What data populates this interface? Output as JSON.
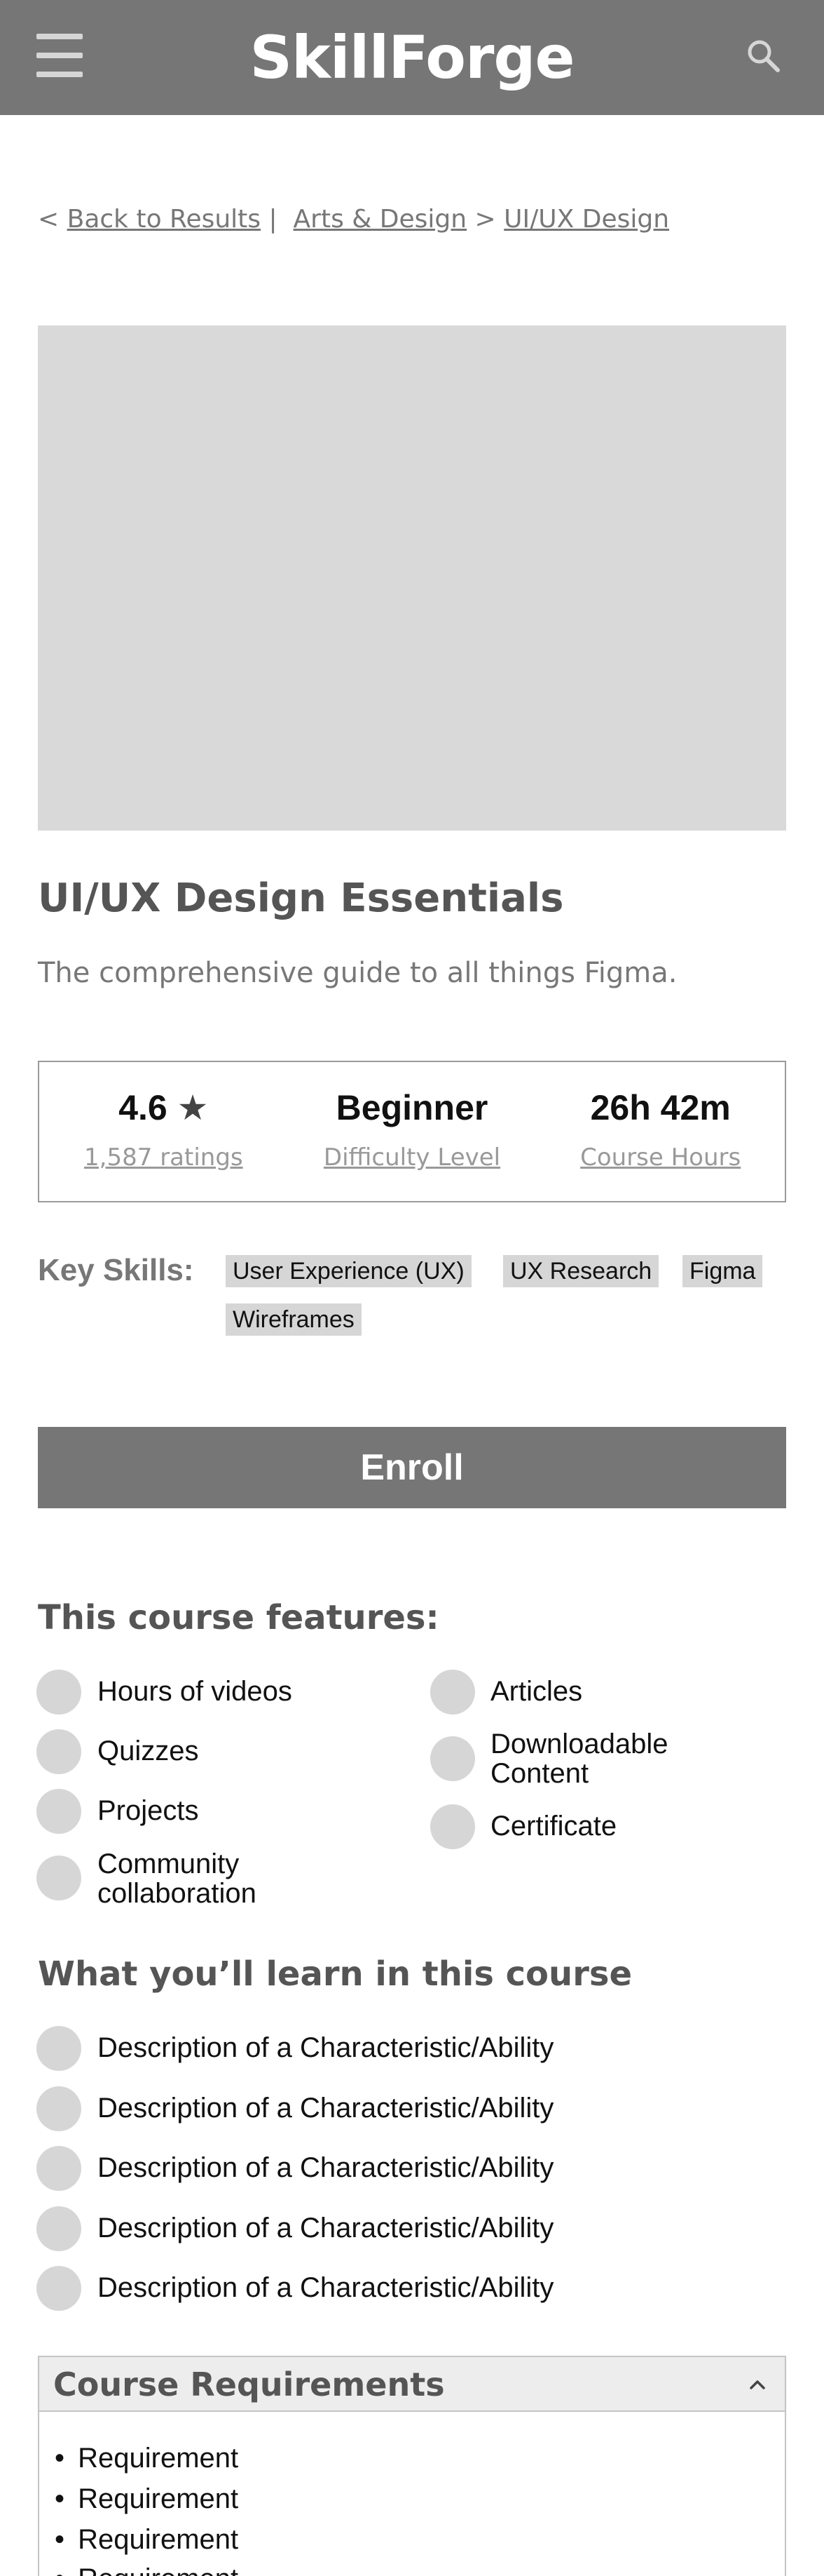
{
  "header": {
    "logo": "SkillForge",
    "menu_icon": "hamburger-menu-icon",
    "search_icon": "search-icon"
  },
  "breadcrumb": {
    "back_prefix": "<",
    "back": "Back to Results",
    "divider": "|",
    "category": "Arts & Design",
    "arrow": ">",
    "current": "UI/UX Design"
  },
  "course": {
    "title": "UI/UX Design Essentials",
    "subtitle": "The comprehensive guide to all things Figma."
  },
  "stats": {
    "rating": "4.6",
    "star": "★",
    "ratings_count": "1,587 ratings",
    "difficulty": "Beginner",
    "difficulty_label": "Difficulty Level",
    "hours": "26h 42m",
    "hours_label": "Course Hours"
  },
  "skills": {
    "label": "Key Skills:",
    "items": [
      "User Experience (UX)",
      "UX Research",
      "Figma",
      "Wireframes"
    ]
  },
  "enroll_label": "Enroll",
  "features": {
    "heading": "This course features:",
    "left": [
      "Hours of videos",
      "Quizzes",
      "Projects",
      "Community collaboration"
    ],
    "right": [
      "Articles",
      "Downloadable Content",
      "Certificate"
    ]
  },
  "learn": {
    "heading": "What you’ll learn in this course",
    "items": [
      "Description of a Characteristic/Ability",
      "Description of a Characteristic/Ability",
      "Description of a Characteristic/Ability",
      "Description of a Characteristic/Ability",
      "Description of a Characteristic/Ability"
    ]
  },
  "requirements": {
    "heading": "Course Requirements",
    "bullet": "•",
    "items": [
      "Requirement",
      "Requirement",
      "Requirement",
      "Requirement"
    ]
  },
  "colors": {
    "header_bg": "#767676",
    "placeholder": "#d9d9d9",
    "button_bg": "#767676"
  }
}
